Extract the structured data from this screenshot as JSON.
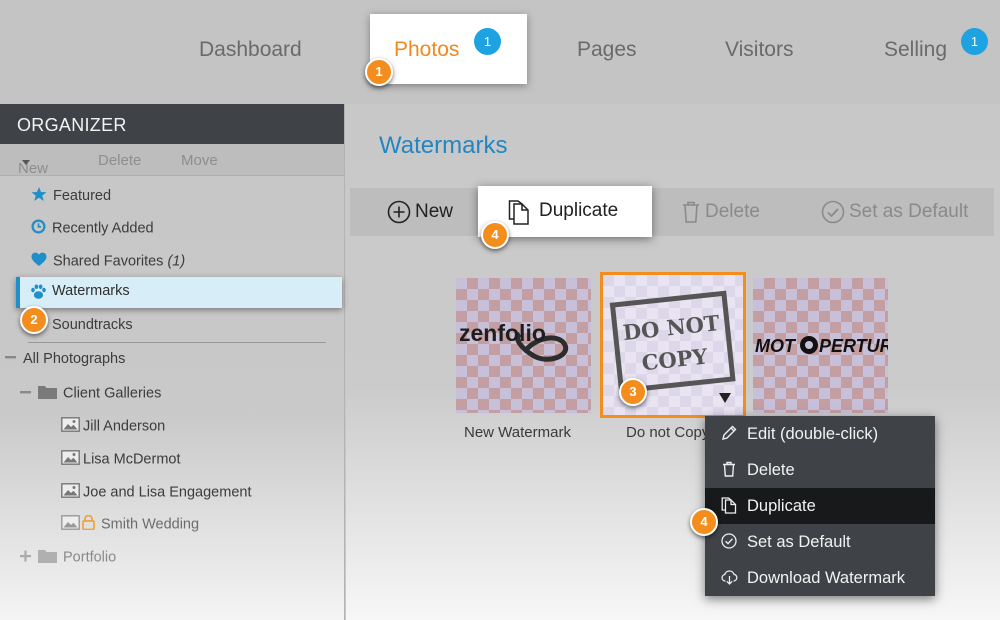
{
  "topnav": {
    "tabs": [
      {
        "label": "Dashboard"
      },
      {
        "label": "Photos",
        "badge": "1",
        "active": true
      },
      {
        "label": "Pages"
      },
      {
        "label": "Visitors"
      },
      {
        "label": "Selling",
        "badge": "1"
      }
    ]
  },
  "callouts": {
    "c1": "1",
    "c2": "2",
    "c3": "3",
    "c4a": "4",
    "c4b": "4"
  },
  "sidebar": {
    "header": "ORGANIZER",
    "actions": {
      "new": "New",
      "delete": "Delete",
      "move": "Move"
    },
    "items": [
      {
        "label": "Featured",
        "icon": "star-icon"
      },
      {
        "label": "Recently Added",
        "icon": "clock-icon"
      },
      {
        "label": "Shared Favorites",
        "count": "(1)",
        "icon": "heart-icon"
      },
      {
        "label": "Watermarks",
        "icon": "paw-icon",
        "selected": true
      },
      {
        "label": "Soundtracks",
        "icon": "music-icon"
      }
    ],
    "tree": {
      "all_photographs": "All Photographs",
      "client_galleries": "Client Galleries",
      "galleries": [
        "Jill Anderson",
        "Lisa McDermot",
        "Joe and Lisa Engagement",
        "Smith Wedding"
      ],
      "portfolio": "Portfolio"
    }
  },
  "main": {
    "title": "Watermarks",
    "toolbar": {
      "new": "New",
      "duplicate": "Duplicate",
      "delete": "Delete",
      "set_default": "Set as Default"
    },
    "thumbs": [
      {
        "label": "New Watermark",
        "logo": "zenfolio"
      },
      {
        "label": "Do not Copy",
        "logo": "DO NOT COPY",
        "line1": "DO NOT",
        "line2": "COPY"
      },
      {
        "label": "",
        "logo": "MOTOPERTURE",
        "logo_a": "MOT",
        "logo_b": "PERTURE"
      }
    ],
    "context_menu": [
      "Edit (double-click)",
      "Delete",
      "Duplicate",
      "Set as Default",
      "Download Watermark"
    ]
  },
  "colors": {
    "accent_orange": "#f28d1e",
    "link_blue": "#2385c2",
    "badge_blue": "#1fa2e1",
    "menu_bg": "#3f4347"
  }
}
